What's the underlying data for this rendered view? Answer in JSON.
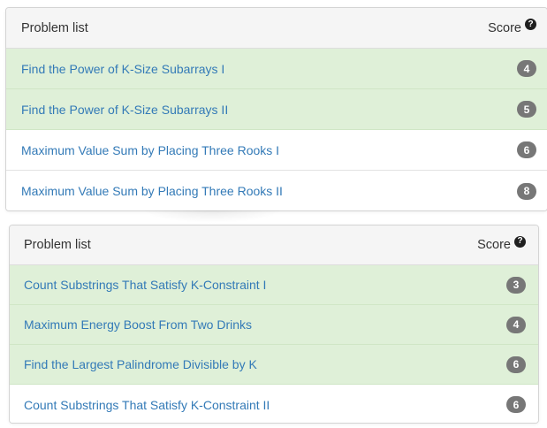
{
  "panels": [
    {
      "header": {
        "title": "Problem list",
        "score_label": "Score",
        "help_icon": "question-circle-icon"
      },
      "rows": [
        {
          "title": "Find the Power of K-Size Subarrays I",
          "score": "4",
          "status": "solved"
        },
        {
          "title": "Find the Power of K-Size Subarrays II",
          "score": "5",
          "status": "solved"
        },
        {
          "title": "Maximum Value Sum by Placing Three Rooks I",
          "score": "6",
          "status": "unsolved"
        },
        {
          "title": "Maximum Value Sum by Placing Three Rooks II",
          "score": "8",
          "status": "unsolved"
        }
      ]
    },
    {
      "header": {
        "title": "Problem list",
        "score_label": "Score",
        "help_icon": "question-circle-icon"
      },
      "rows": [
        {
          "title": "Count Substrings That Satisfy K-Constraint I",
          "score": "3",
          "status": "solved"
        },
        {
          "title": "Maximum Energy Boost From Two Drinks",
          "score": "4",
          "status": "solved"
        },
        {
          "title": "Find the Largest Palindrome Divisible by K",
          "score": "6",
          "status": "solved"
        },
        {
          "title": "Count Substrings That Satisfy K-Constraint II",
          "score": "6",
          "status": "unsolved"
        }
      ]
    }
  ],
  "colors": {
    "solved_row": "#dff0d8",
    "link": "#337ab7",
    "badge": "#777777",
    "header_bg": "#f5f5f5"
  }
}
